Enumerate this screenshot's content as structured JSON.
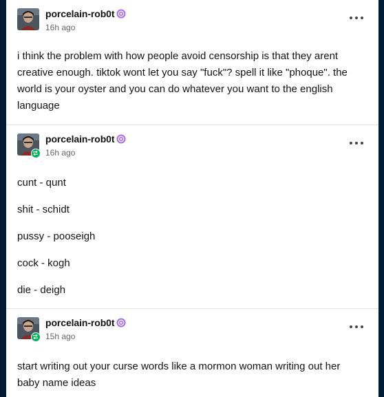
{
  "posts": [
    {
      "username": "porcelain-rob0t",
      "timestamp": "16h ago",
      "reblogged": false,
      "paragraphs": [
        "i think the problem with how people avoid censorship is that they arent creative enough. tiktok wont let you say \"fuck\"? spell it like \"phoque\". the world is your oyster and you can do whatever you want to the english language"
      ]
    },
    {
      "username": "porcelain-rob0t",
      "timestamp": "16h ago",
      "reblogged": true,
      "paragraphs": [
        "cunt - qunt",
        "shit - schidt",
        "pussy - pooseigh",
        "cock - kogh",
        "die - deigh"
      ]
    },
    {
      "username": "porcelain-rob0t",
      "timestamp": "15h ago",
      "reblogged": true,
      "paragraphs": [
        "start writing out your curse words like a mormon woman writing out her baby name ideas"
      ]
    }
  ],
  "colors": {
    "background": "#001935",
    "card": "#ffffff",
    "verified_badge": "#a66cf0",
    "reblog_badge": "#00b45a",
    "timestamp": "#646464"
  },
  "icons": {
    "verified": "verified-badge-icon",
    "reblog": "reblog-icon",
    "more": "ellipsis-icon"
  }
}
